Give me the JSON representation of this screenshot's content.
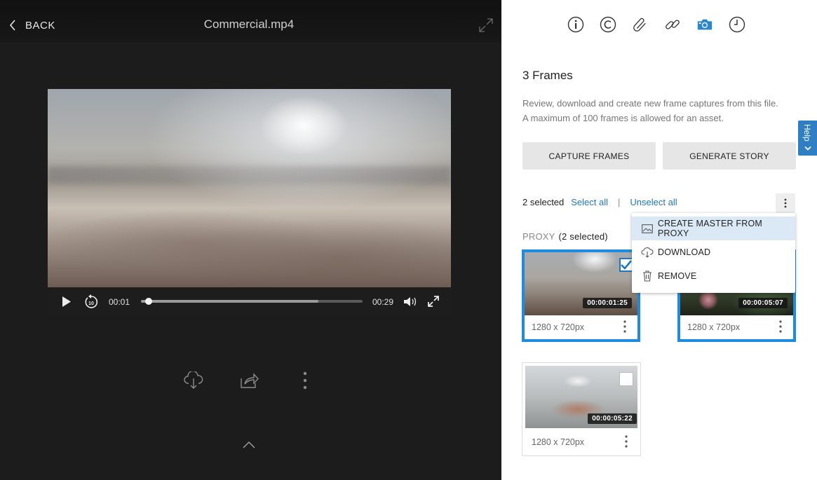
{
  "viewer": {
    "back_label": "BACK",
    "file_name": "Commercial.mp4",
    "player": {
      "current_time": "00:01",
      "duration": "00:29",
      "progress_fraction": 0.034,
      "buffered_fraction": 0.8
    },
    "actions": [
      "download-icon",
      "share-icon",
      "more-icon"
    ]
  },
  "panel": {
    "tabs": [
      {
        "name": "info-icon"
      },
      {
        "name": "copyright-icon"
      },
      {
        "name": "attachment-icon"
      },
      {
        "name": "link-icon"
      },
      {
        "name": "camera-icon",
        "active": true
      },
      {
        "name": "history-icon"
      }
    ],
    "title": "3 Frames",
    "desc_line1": "Review, download and create new frame captures from this file.",
    "desc_line2": "A maximum of 100 frames is allowed for an asset.",
    "capture_button": "CAPTURE FRAMES",
    "story_button": "GENERATE STORY",
    "selected_count": "2 selected",
    "select_all": "Select all",
    "divider": "|",
    "unselect_all": "Unselect all",
    "proxy_label": "PROXY",
    "proxy_count": "(2 selected)",
    "frames": [
      {
        "timecode": "00:00:01:25",
        "resolution": "1280 x 720px",
        "selected": true
      },
      {
        "timecode": "00:00:05:07",
        "resolution": "1280 x 720px",
        "selected": true
      },
      {
        "timecode": "00:00:05:22",
        "resolution": "1280 x 720px",
        "selected": false
      }
    ],
    "menu": [
      {
        "label": "CREATE MASTER FROM PROXY",
        "icon": "image-icon"
      },
      {
        "label": "DOWNLOAD",
        "icon": "cloud-download-icon"
      },
      {
        "label": "REMOVE",
        "icon": "trash-icon"
      }
    ],
    "help_label": "Help"
  },
  "colors": {
    "accent": "#1d8ce0",
    "link": "#1d78c1",
    "viewer_bg": "#1c1c1c"
  }
}
